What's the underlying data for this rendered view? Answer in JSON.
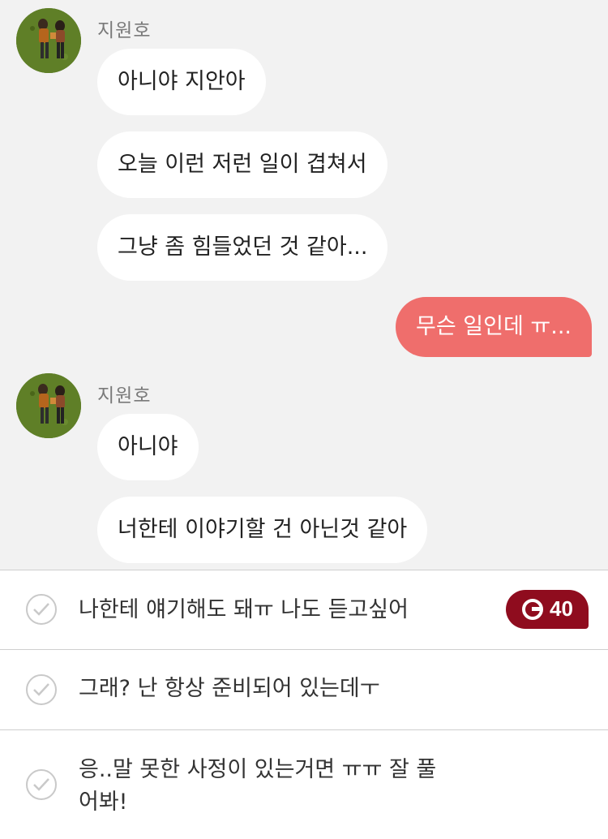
{
  "messages": [
    {
      "sender": "지원호",
      "bubbles": [
        "아니야 지안아",
        "오늘 이런 저런 일이 겹쳐서",
        "그냥 좀 힘들었던 것 같아..."
      ]
    },
    {
      "outgoing": "무슨 일인데 ㅠ..."
    },
    {
      "sender": "지원호",
      "bubbles": [
        "아니야",
        "너한테 이야기할 건 아닌것 같아"
      ]
    }
  ],
  "options": [
    {
      "text": "나한테 얘기해도 돼ㅠ 나도 듣고싶어",
      "badge": "40"
    },
    {
      "text": "그래? 난 항상 준비되어 있는데ㅜ"
    },
    {
      "text": "응..말 못한 사정이 있는거면 ㅠㅠ 잘 풀\n어봐!"
    }
  ],
  "colors": {
    "outgoing_bubble": "#ef6e6c",
    "badge": "#8f0c1e",
    "background": "#f2f2f2"
  },
  "icons": [
    "avatar",
    "check-circle-icon",
    "gem-icon"
  ]
}
